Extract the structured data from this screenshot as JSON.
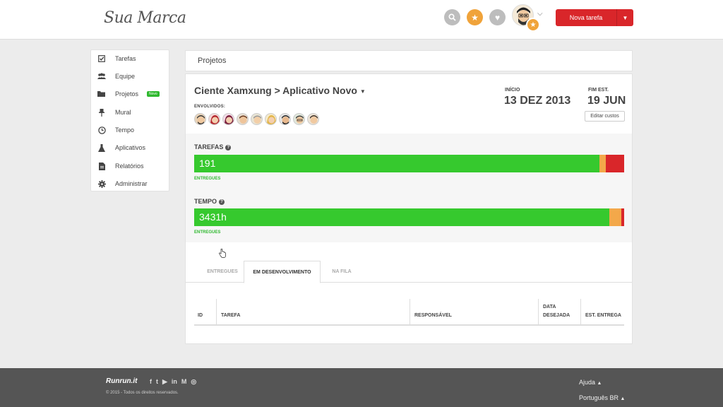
{
  "header": {
    "brand": "Sua Marca",
    "new_task_label": "Nova tarefa",
    "colors": {
      "search": "#bdbdbd",
      "star": "#f0a33a",
      "heart": "#bdbdbd",
      "primary": "#d9262a"
    }
  },
  "sidebar": {
    "items": [
      {
        "label": "Tarefas",
        "icon": "check-square-icon"
      },
      {
        "label": "Equipe",
        "icon": "team-icon"
      },
      {
        "label": "Projetos",
        "icon": "folder-icon",
        "badge": "Novo"
      },
      {
        "label": "Mural",
        "icon": "pin-icon"
      },
      {
        "label": "Tempo",
        "icon": "clock-icon"
      },
      {
        "label": "Aplicativos",
        "icon": "flask-icon"
      },
      {
        "label": "Relatórios",
        "icon": "document-icon"
      },
      {
        "label": "Administrar",
        "icon": "gear-icon"
      }
    ]
  },
  "breadcrumb": "Projetos",
  "project": {
    "title": "Ciente Xamxung > Aplicativo Novo",
    "involved_label": "ENVOLVIDOS:",
    "start_label": "INÍCIO",
    "start_date": "13 DEZ 2013",
    "end_label": "FIM EST.",
    "end_date": "19 JUN",
    "edit_costs": "Editar custos"
  },
  "stats": {
    "tasks": {
      "label": "TAREFAS",
      "value": "191",
      "sub": "ENTREGUES",
      "fractions": {
        "delivered": 0.943,
        "in_progress": 0.014,
        "late": 0.043
      }
    },
    "time": {
      "label": "TEMPO",
      "value": "3431h",
      "sub": "ENTREGUES",
      "fractions": {
        "delivered": 0.965,
        "in_progress": 0.028,
        "late": 0.007
      }
    },
    "colors": {
      "delivered": "#36c92e",
      "in_progress": "#f3a84a",
      "late": "#d9262a"
    }
  },
  "tabs": [
    "ENTREGUES",
    "EM DESENVOLVIMENTO",
    "NA FILA"
  ],
  "table": {
    "headers": [
      "ID",
      "TAREFA",
      "RESPONSÁVEL",
      "DATA DESEJADA",
      "EST. ENTREGA"
    ]
  },
  "footer": {
    "logo": "Runrun.it",
    "copyright": "© 2015 - Todos os direitos reservados.",
    "help": "Ajuda",
    "language": "Português BR"
  }
}
